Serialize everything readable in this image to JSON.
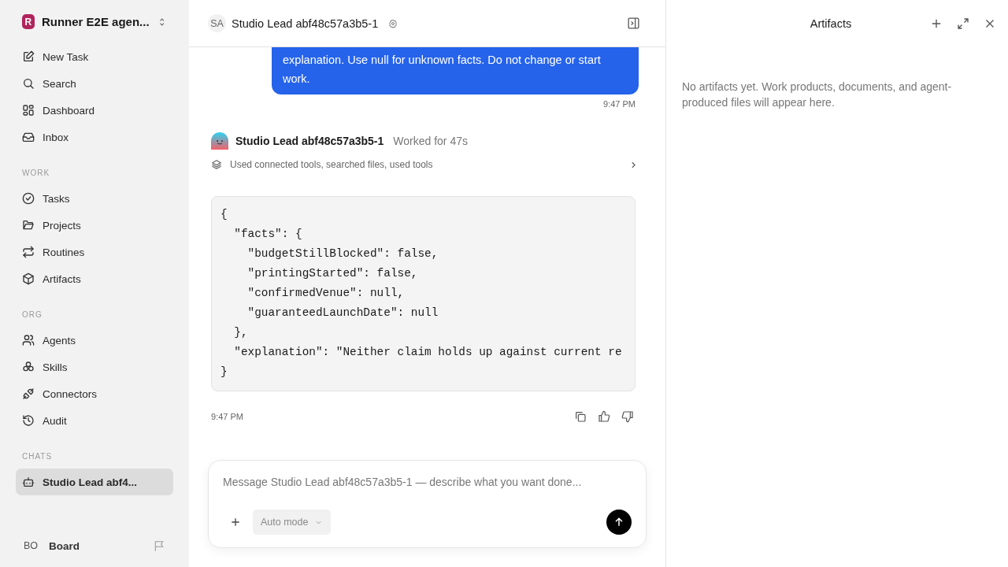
{
  "sidebar": {
    "workspace": {
      "initial": "R",
      "name": "Runner E2E agen..."
    },
    "nav": [
      {
        "label": "New Task",
        "selected": false
      },
      {
        "label": "Search",
        "selected": false
      },
      {
        "label": "Dashboard",
        "selected": false
      },
      {
        "label": "Inbox",
        "selected": false
      }
    ],
    "sections": [
      {
        "title": "WORK",
        "items": [
          {
            "label": "Tasks",
            "selected": false
          },
          {
            "label": "Projects",
            "selected": false
          },
          {
            "label": "Routines",
            "selected": false
          },
          {
            "label": "Artifacts",
            "selected": false
          }
        ]
      },
      {
        "title": "ORG",
        "items": [
          {
            "label": "Agents",
            "selected": false
          },
          {
            "label": "Skills",
            "selected": false
          },
          {
            "label": "Connectors",
            "selected": false
          },
          {
            "label": "Audit",
            "selected": false
          }
        ]
      },
      {
        "title": "CHATS",
        "items": [
          {
            "label": "Studio Lead abf4...",
            "selected": true
          }
        ]
      }
    ],
    "user": {
      "initials": "BO",
      "name": "Board"
    }
  },
  "chat": {
    "header": {
      "initials": "SA",
      "title": "Studio Lead abf48c57a3b5-1"
    },
    "user_message": {
      "text": "explanation. Use null for unknown facts. Do not change or start work.",
      "time": "9:47 PM"
    },
    "agent_message": {
      "name": "Studio Lead abf48c57a3b5-1",
      "status": "Worked for 47s",
      "tools": "Used connected tools, searched files, used tools",
      "code": "{\n  \"facts\": {\n    \"budgetStillBlocked\": false,\n    \"printingStarted\": false,\n    \"confirmedVenue\": null,\n    \"guaranteedLaunchDate\": null\n  },\n  \"explanation\": \"Neither claim holds up against current re\n}",
      "time": "9:47 PM"
    },
    "composer": {
      "placeholder": "Message Studio Lead abf48c57a3b5-1 — describe what you want done...",
      "mode": "Auto mode"
    }
  },
  "artifacts": {
    "title": "Artifacts",
    "empty_text": "No artifacts yet. Work products, documents, and agent-produced files will appear here."
  }
}
